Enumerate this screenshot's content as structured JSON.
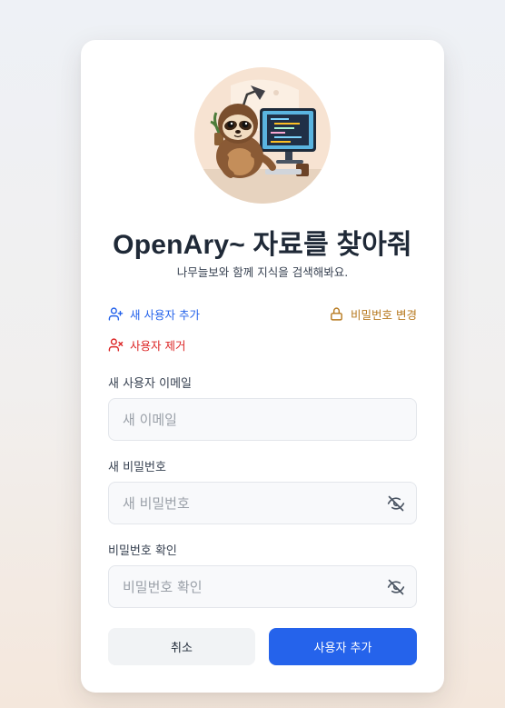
{
  "header": {
    "title": "OpenAry~ 자료를 찾아줘",
    "subtitle": "나무늘보와 함께 지식을 검색해봐요."
  },
  "actions": {
    "add_user": {
      "label": "새 사용자 추가",
      "icon": "user-plus-icon"
    },
    "change_password": {
      "label": "비밀번호 변경",
      "icon": "lock-icon"
    },
    "remove_user": {
      "label": "사용자 제거",
      "icon": "user-x-icon"
    }
  },
  "form": {
    "email": {
      "label": "새 사용자 이메일",
      "placeholder": "새 이메일",
      "value": ""
    },
    "password": {
      "label": "새 비밀번호",
      "placeholder": "새 비밀번호",
      "value": "",
      "icon": "eye-off-icon"
    },
    "confirm": {
      "label": "비밀번호 확인",
      "placeholder": "비밀번호 확인",
      "value": "",
      "icon": "eye-off-icon"
    }
  },
  "buttons": {
    "cancel": "취소",
    "submit": "사용자 추가"
  },
  "colors": {
    "primary": "#2563eb",
    "warning": "#b7791f",
    "danger": "#dc2626",
    "avatar_bg": "#f7e3d2"
  }
}
